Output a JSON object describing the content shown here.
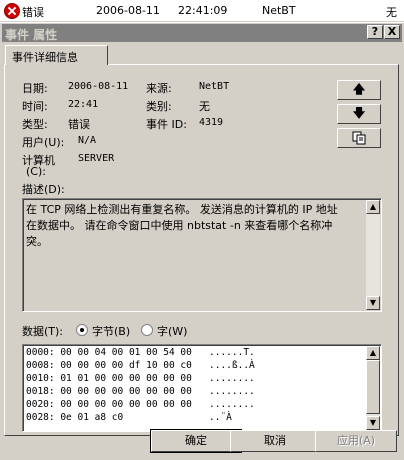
{
  "event_row": {
    "type": "错误",
    "date": "2006-08-11",
    "time": "22:41:09",
    "source": "NetBT",
    "extra": "无"
  },
  "dialog": {
    "title": "事件 属性",
    "help_button": "?",
    "close_button": "X",
    "tab_label": "事件详细信息"
  },
  "details": {
    "date_label": "日期:",
    "date_value": "2006-08-11",
    "source_label": "来源:",
    "source_value": "NetBT",
    "time_label": "时间:",
    "time_value": "22:41",
    "category_label": "类别:",
    "category_value": "无",
    "type_label": "类型:",
    "type_value": "错误",
    "event_id_label": "事件 ID:",
    "event_id_value": "4319",
    "user_label": "用户(U):",
    "user_value": "N/A",
    "computer_label_1": "计算机",
    "computer_label_2": "(C):",
    "computer_value": "SERVER"
  },
  "nav": {
    "up_icon": "arrow-up-icon",
    "down_icon": "arrow-down-icon",
    "copy_icon": "copy-icon"
  },
  "description": {
    "label": "描述(D):",
    "text": "在 TCP 网络上检测出有重复名称。 发送消息的计算机的 IP 地址\n在数据中。 请在命令窗口中使用 nbtstat -n 来查看哪个名称冲\n突。"
  },
  "data": {
    "label": "数据(T):",
    "option_bytes": "字节(B)",
    "option_words": "字(W)",
    "selected": "bytes",
    "lines": [
      "0000: 00 00 04 00 01 00 54 00   ......T.",
      "0008: 00 00 00 00 df 10 00 c0   ....ß..À",
      "0010: 01 01 00 00 00 00 00 00   ........",
      "0018: 00 00 00 00 00 00 00 00   ........",
      "0020: 00 00 00 00 00 00 00 00   ........",
      "0028: 0e 01 a8 c0               ..¨À"
    ]
  },
  "buttons": {
    "ok": "确定",
    "cancel": "取消",
    "apply": "应用(A)"
  }
}
